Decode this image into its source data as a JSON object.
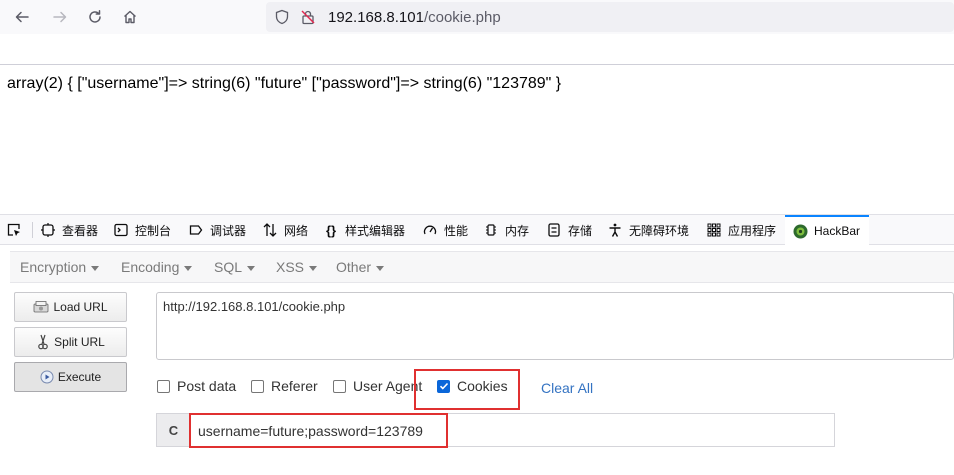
{
  "browser": {
    "url_host": "192.168.8.101",
    "url_path": "/cookie.php",
    "nav_icons": [
      "back-arrow-icon",
      "forward-arrow-icon",
      "reload-icon",
      "home-icon"
    ]
  },
  "page": {
    "output": "array(2) { [\"username\"]=> string(6) \"future\" [\"password\"]=> string(6) \"123789\" }"
  },
  "devtools": {
    "tabs": [
      {
        "label": "查看器",
        "icon": "inspector-icon"
      },
      {
        "label": "控制台",
        "icon": "console-icon"
      },
      {
        "label": "调试器",
        "icon": "debugger-icon"
      },
      {
        "label": "网络",
        "icon": "network-icon"
      },
      {
        "label": "样式编辑器",
        "icon": "style-editor-icon"
      },
      {
        "label": "性能",
        "icon": "performance-icon"
      },
      {
        "label": "内存",
        "icon": "memory-icon"
      },
      {
        "label": "存储",
        "icon": "storage-icon"
      },
      {
        "label": "无障碍环境",
        "icon": "accessibility-icon"
      },
      {
        "label": "应用程序",
        "icon": "application-icon"
      },
      {
        "label": "HackBar",
        "icon": "hackbar-icon",
        "active": true
      }
    ]
  },
  "hackbar": {
    "menu": [
      "Encryption",
      "Encoding",
      "SQL",
      "XSS",
      "Other"
    ],
    "buttons": {
      "load_url": "Load URL",
      "split_url": "Split URL",
      "execute": "Execute"
    },
    "url_value": "http://192.168.8.101/cookie.php",
    "options": {
      "post_data": "Post data",
      "referer": "Referer",
      "user_agent": "User Agent",
      "cookies": "Cookies",
      "clear_all": "Clear All"
    },
    "cookie_prefix": "C",
    "cookie_value": "username=future;password=123789"
  },
  "colors": {
    "accent": "#0a84ff",
    "highlight_box": "#e03030",
    "link": "#3473c2"
  }
}
